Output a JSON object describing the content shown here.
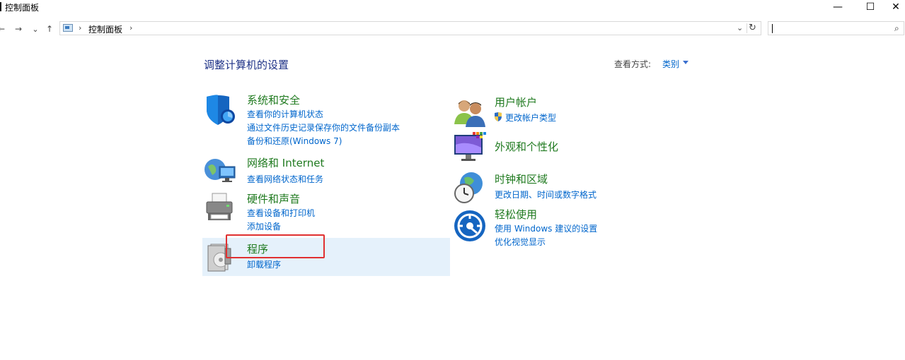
{
  "window": {
    "title": "控制面板",
    "minimize": "—",
    "maximize": "☐",
    "close": "✕"
  },
  "nav": {
    "back": "←",
    "forward": "→",
    "recent": "⌄",
    "up": "↑",
    "breadcrumb_sep1": "›",
    "breadcrumb": "控制面板",
    "breadcrumb_sep2": "›",
    "dropdown": "⌄",
    "refresh": "↻"
  },
  "search": {
    "placeholder": "",
    "icon": "⌕"
  },
  "main": {
    "heading": "调整计算机的设置",
    "view_by_label": "查看方式:",
    "view_by_value": "类别"
  },
  "categories_left": [
    {
      "title": "系统和安全",
      "icon": "shield-icon",
      "links": [
        "查看你的计算机状态",
        "通过文件历史记录保存你的文件备份副本",
        "备份和还原(Windows 7)"
      ]
    },
    {
      "title": "网络和 Internet",
      "icon": "network-icon",
      "links": [
        "查看网络状态和任务"
      ]
    },
    {
      "title": "硬件和声音",
      "icon": "printer-icon",
      "links": [
        "查看设备和打印机",
        "添加设备"
      ]
    },
    {
      "title": "程序",
      "icon": "programs-icon",
      "links": [
        "卸载程序"
      ]
    }
  ],
  "categories_right": [
    {
      "title": "用户帐户",
      "icon": "users-icon",
      "links": [
        "更改帐户类型"
      ]
    },
    {
      "title": "外观和个性化",
      "icon": "display-icon",
      "links": []
    },
    {
      "title": "时钟和区域",
      "icon": "clock-globe-icon",
      "links": [
        "更改日期、时间或数字格式"
      ]
    },
    {
      "title": "轻松使用",
      "icon": "ease-of-access-icon",
      "links": [
        "使用 Windows 建议的设置",
        "优化视觉显示"
      ]
    }
  ],
  "colors": {
    "category_title": "#1f7a1f",
    "link": "#0066cc",
    "heading": "#1e3287",
    "highlight": "#e5f1fb",
    "annotation": "#e03030"
  }
}
